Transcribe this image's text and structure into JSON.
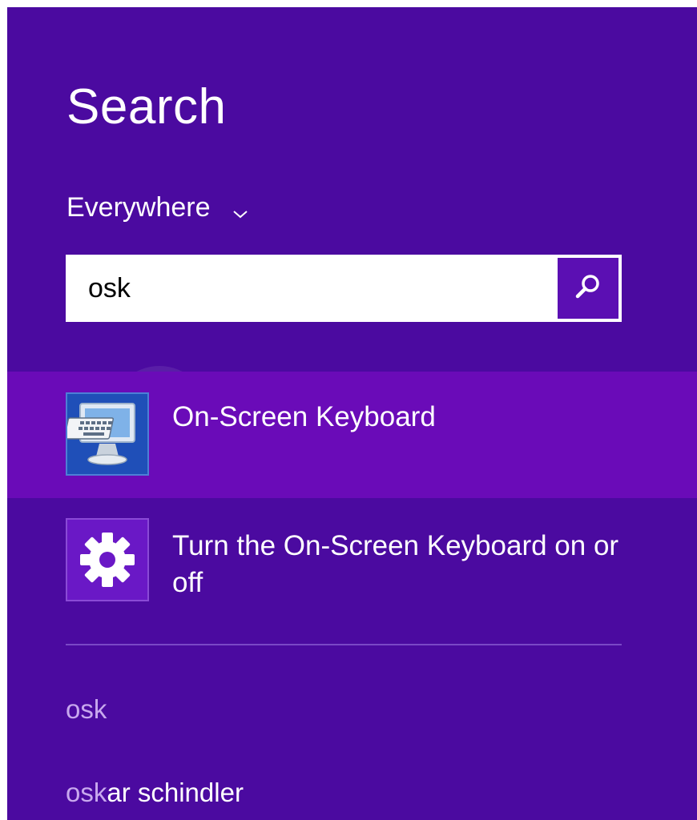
{
  "panel": {
    "title": "Search",
    "scope": {
      "label": "Everywhere",
      "icon": "chevron-down-icon"
    },
    "search": {
      "value": "osk",
      "placeholder": "",
      "button_icon": "search-icon"
    }
  },
  "results": [
    {
      "label": "On-Screen Keyboard",
      "icon": "on-screen-keyboard-icon",
      "selected": true
    },
    {
      "label": "Turn the On-Screen Keyboard on or off",
      "icon": "gear-icon",
      "selected": false
    }
  ],
  "suggestions": [
    {
      "typed": "osk",
      "rest": ""
    },
    {
      "typed": "osk",
      "rest": "ar schindler"
    }
  ],
  "colors": {
    "background": "#4b0aa0",
    "selected_row": "#6a0bb8",
    "suggestion_dim": "#c8a8ee",
    "search_button": "#5b0fb3"
  }
}
